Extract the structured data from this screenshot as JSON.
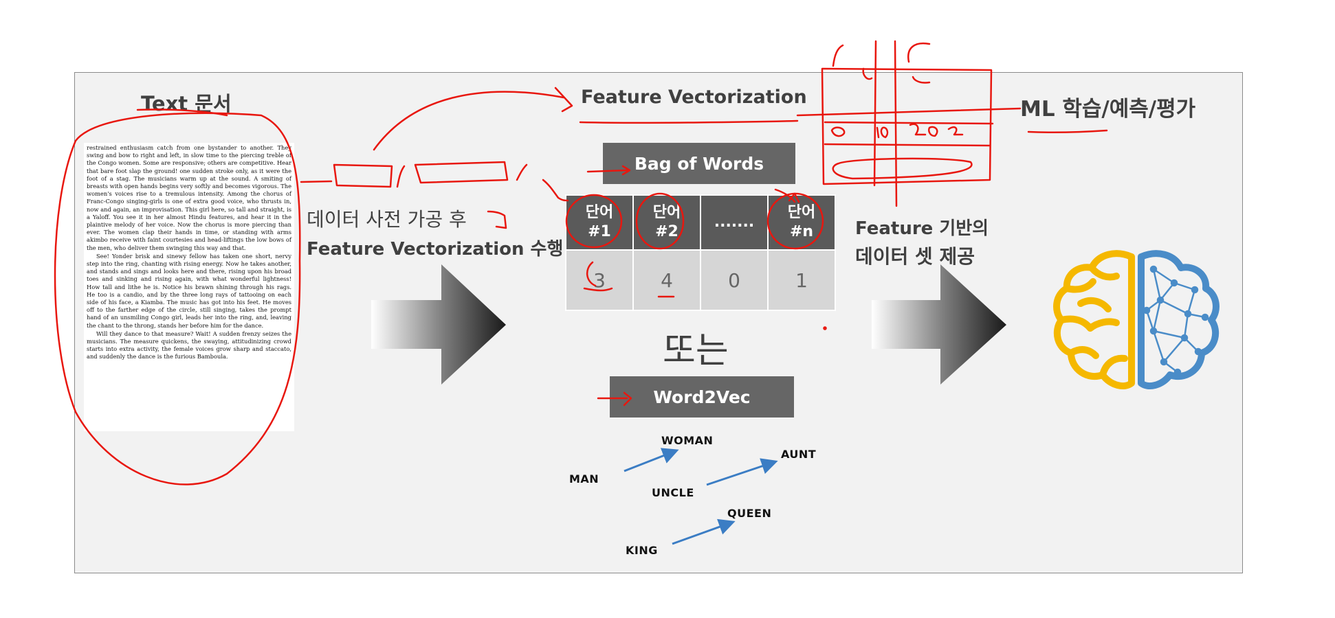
{
  "left_title": "Text 문서",
  "document_paragraphs": [
    "restrained enthusiasm catch from one bystander to another. They swing and bow to right and left, in slow time to the piercing treble of the Congo women. Some are responsive; others are competitive. Hear that bare foot slap the ground! one sudden stroke only, as it were the foot of a stag. The musicians warm up at the sound. A smiting of breasts with open hands begins very softly and becomes vigorous. The women's voices rise to a tremulous intensity. Among the chorus of Franc-Congo singing-girls is one of extra good voice, who thrusts in, now and again, an improvisation. This girl here, so tall and straight, is a Yaloff. You see it in her almost Hindu features, and hear it in the plaintive melody of her voice. Now the chorus is more piercing than ever. The women clap their hands in time, or standing with arms akimbo receive with faint courtesies and head-liftings the low bows of the men, who deliver them swinging this way and that.",
    "See! Yonder brisk and sinewy fellow has taken one short, nervy step into the ring, chanting with rising energy. Now he takes another, and stands and sings and looks here and there, rising upon his broad toes and sinking and rising again, with what wonderful lightness! How tall and lithe he is. Notice his brawn shining through his rags. He too is a candio, and by the three long rays of tattooing on each side of his face, a Kiamba. The music has got into his feet. He moves off to the farther edge of the circle, still singing, takes the prompt hand of an unsmiling Congo girl, leads her into the ring, and, leaving the chant to the throng, stands her before him for the dance.",
    "Will they dance to that measure? Wait! A sudden frenzy seizes the musicians. The measure quickens, the swaying, attitudinizing crowd starts into extra activity, the female voices grow sharp and staccato, and suddenly the dance is the furious Bamboula."
  ],
  "step1_line1": "데이터 사전 가공 후",
  "step1_line2": "Feature Vectorization 수행",
  "center_title": "Feature Vectorization",
  "bow_label": "Bag of Words",
  "bow_headers": [
    {
      "line1": "단어",
      "line2": "#1"
    },
    {
      "line1": "단어",
      "line2": "#2"
    },
    {
      "line1": ".......",
      "line2": ""
    },
    {
      "line1": "단어",
      "line2": "#n"
    }
  ],
  "bow_values": [
    "3",
    "4",
    "0",
    "1"
  ],
  "or_text": "또는",
  "w2v_label": "Word2Vec",
  "w2v_words": {
    "woman": "WOMAN",
    "man": "MAN",
    "aunt": "AUNT",
    "uncle": "UNCLE",
    "queen": "QUEEN",
    "king": "KING"
  },
  "step2_line1": "Feature 기반의",
  "step2_line2": "데이터 셋 제공",
  "right_title": "ML 학습/예측/평가",
  "handwritten": [
    "0",
    "10",
    "20.2"
  ],
  "colors": {
    "annotation": "#e8170f",
    "dark_box": "#666666",
    "table_header": "#5a5a5a",
    "table_cell": "#d6d6d6",
    "vector_arrow": "#3b7dc4",
    "brain_left": "#f5b800",
    "brain_right": "#4a8cc8"
  }
}
